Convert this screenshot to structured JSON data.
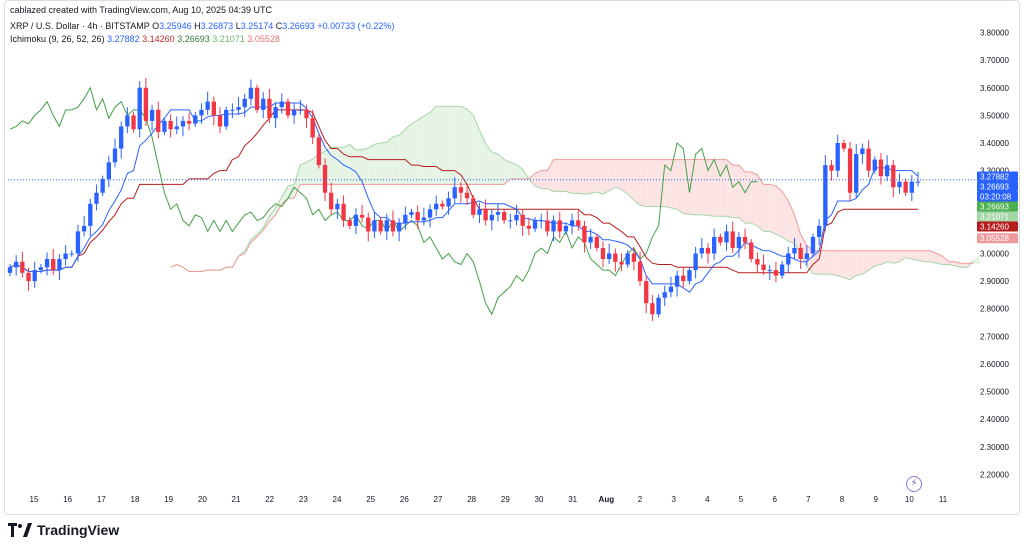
{
  "header": {
    "credit": "cablazed created with TradingView.com, Aug 10, 2025 04:39 UTC",
    "symbol": "XRP / U.S. Dollar · 4h · BITSTAMP",
    "o_label": "O",
    "o_value": "3.25946",
    "h_label": "H",
    "h_value": "3.26873",
    "l_label": "L",
    "l_value": "3.25174",
    "c_label": "C",
    "c_value": "3.26693",
    "change": "+0.00733 (+0.22%)",
    "ichimoku_label": "Ichimoku (9, 26, 52, 26)",
    "ichimoku_values": [
      "3.27882",
      "3.14260",
      "3.26693",
      "3.21071",
      "3.05528"
    ]
  },
  "brand": {
    "name": "TradingView"
  },
  "colors": {
    "up": "#2962ff",
    "down": "#f23645",
    "conversion": "#2962ff",
    "base": "#b71c1c",
    "lagging": "#43a047",
    "cloud_up": "#e6f4e6",
    "cloud_down": "#fde4e4",
    "lead_a": "#a5d6a7",
    "lead_b": "#ef9a9a",
    "last_price_line": "#2962ff"
  },
  "chart_data": {
    "type": "candlestick",
    "symbol": "XRP / U.S. Dollar",
    "interval": "4h",
    "exchange": "BITSTAMP",
    "ylim": [
      2.18,
      3.82
    ],
    "y_ticks": [
      "3.80000",
      "3.70000",
      "3.60000",
      "3.50000",
      "3.40000",
      "3.30000",
      "3.20000",
      "3.10000",
      "3.00000",
      "2.90000",
      "2.80000",
      "2.70000",
      "2.60000",
      "2.50000",
      "2.40000",
      "2.30000",
      "2.20000"
    ],
    "x_ticks": [
      "15",
      "16",
      "17",
      "18",
      "19",
      "20",
      "21",
      "22",
      "23",
      "24",
      "25",
      "26",
      "27",
      "28",
      "29",
      "30",
      "31",
      "Aug",
      "2",
      "3",
      "4",
      "5",
      "6",
      "7",
      "8",
      "9",
      "10",
      "11"
    ],
    "close_series": [
      2.95,
      2.97,
      2.93,
      2.9,
      2.94,
      2.95,
      2.98,
      2.94,
      2.98,
      3.0,
      3.0,
      3.08,
      3.1,
      3.18,
      3.22,
      3.27,
      3.33,
      3.38,
      3.46,
      3.5,
      3.45,
      3.6,
      3.48,
      3.52,
      3.44,
      3.48,
      3.45,
      3.46,
      3.48,
      3.47,
      3.5,
      3.52,
      3.55,
      3.5,
      3.46,
      3.52,
      3.52,
      3.53,
      3.56,
      3.6,
      3.52,
      3.56,
      3.49,
      3.53,
      3.55,
      3.5,
      3.52,
      3.52,
      3.49,
      3.42,
      3.32,
      3.22,
      3.16,
      3.18,
      3.12,
      3.1,
      3.14,
      3.13,
      3.08,
      3.12,
      3.08,
      3.12,
      3.08,
      3.11,
      3.14,
      3.15,
      3.12,
      3.13,
      3.16,
      3.18,
      3.17,
      3.2,
      3.24,
      3.22,
      3.2,
      3.14,
      3.16,
      3.12,
      3.14,
      3.15,
      3.12,
      3.12,
      3.14,
      3.1,
      3.09,
      3.12,
      3.12,
      3.08,
      3.12,
      3.08,
      3.1,
      3.12,
      3.1,
      3.04,
      3.06,
      3.02,
      2.98,
      3.0,
      2.97,
      2.96,
      3.0,
      2.97,
      2.9,
      2.82,
      2.78,
      2.84,
      2.86,
      2.88,
      2.92,
      2.9,
      2.94,
      3.0,
      3.02,
      3.0,
      3.06,
      3.04,
      3.08,
      3.02,
      3.06,
      3.04,
      2.98,
      2.96,
      2.94,
      2.94,
      2.92,
      2.96,
      3.0,
      3.02,
      2.98,
      3.0,
      3.06,
      3.1,
      3.32,
      3.3,
      3.4,
      3.38,
      3.22,
      3.36,
      3.38,
      3.3,
      3.34,
      3.28,
      3.32,
      3.24,
      3.26,
      3.22,
      3.26,
      3.26
    ],
    "last_price": "3.26693",
    "countdown": "03:20:08",
    "ichimoku": {
      "params": [
        9,
        26,
        52,
        26
      ],
      "conversion_line": 3.27882,
      "base_line": 3.1426,
      "lagging_span": 3.26693,
      "leading_span_a": 3.21071,
      "leading_span_b": 3.05528
    },
    "price_labels": [
      {
        "value": "3.27882",
        "color": "#2962ff"
      },
      {
        "value": "3.26693",
        "color": "#2962ff"
      },
      {
        "value": "03:20:08",
        "color": "#2962ff"
      },
      {
        "value": "3.26693",
        "color": "#4caf50"
      },
      {
        "value": "3.21071",
        "color": "#a5d6a7"
      },
      {
        "value": "3.14260",
        "color": "#b71c1c"
      },
      {
        "value": "3.05528",
        "color": "#ef9a9a"
      }
    ]
  }
}
